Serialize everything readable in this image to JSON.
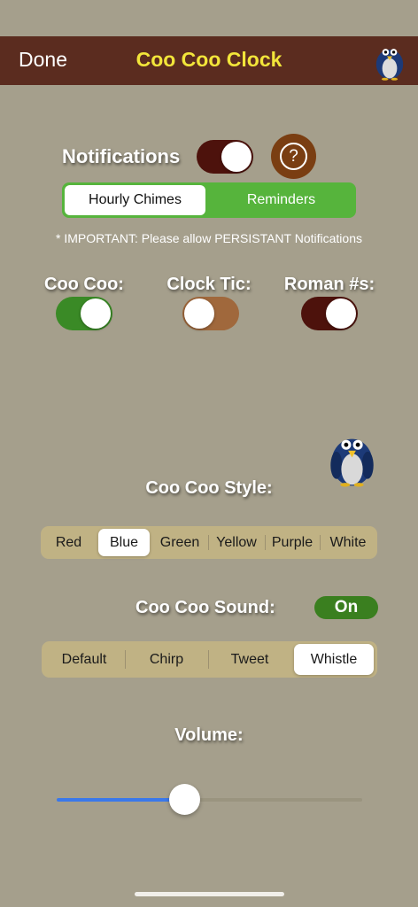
{
  "nav": {
    "done_label": "Done",
    "title": "Coo Coo Clock",
    "bird_icon": "blue-bird-icon"
  },
  "notifications": {
    "label": "Notifications",
    "enabled": true,
    "help_glyph": "?",
    "segments": [
      "Hourly Chimes",
      "Reminders"
    ],
    "selected": "Hourly Chimes",
    "important_note": "* IMPORTANT: Please allow PERSISTANT Notifications"
  },
  "toggles": [
    {
      "label": "Coo Coo:",
      "on": true,
      "color": "#3a8a26"
    },
    {
      "label": "Clock Tic:",
      "on": false,
      "color": "#a0683c"
    },
    {
      "label": "Roman #s:",
      "on": true,
      "color": "#4d120c"
    }
  ],
  "style": {
    "label": "Coo Coo Style:",
    "options": [
      "Red",
      "Blue",
      "Green",
      "Yellow",
      "Purple",
      "White"
    ],
    "selected": "Blue"
  },
  "sound": {
    "label": "Coo Coo Sound:",
    "toggle_label": "On",
    "options": [
      "Default",
      "Chirp",
      "Tweet",
      "Whistle"
    ],
    "selected": "Whistle"
  },
  "volume": {
    "label": "Volume:",
    "level": 0.42
  },
  "colors": {
    "nav_bg": "#5b2c1f",
    "title": "#f2e53a",
    "background": "#a59f8c",
    "accent": "#3a78ea",
    "notif_toggle": "#4d120c"
  }
}
